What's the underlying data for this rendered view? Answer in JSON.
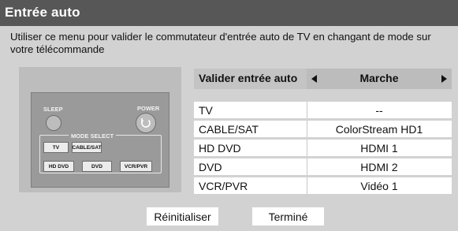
{
  "window": {
    "title": "Entrée auto"
  },
  "description": "Utiliser ce menu pour valider le commutateur d'entrée auto de TV en changant de mode sur votre télécommande",
  "remote": {
    "sleep_label": "SLEEP",
    "power_label": "POWER",
    "mode_select_label": "MODE SELECT",
    "mode_buttons": [
      "TV",
      "CABLE/SAT",
      "HD DVD",
      "DVD",
      "VCR/PVR"
    ]
  },
  "setting": {
    "label": "Valider entrée auto",
    "value": "Marche"
  },
  "inputs": [
    {
      "mode": "TV",
      "input": "--"
    },
    {
      "mode": "CABLE/SAT",
      "input": "ColorStream HD1"
    },
    {
      "mode": "HD DVD",
      "input": "HDMI 1"
    },
    {
      "mode": "DVD",
      "input": "HDMI 2"
    },
    {
      "mode": "VCR/PVR",
      "input": "Vidéo 1"
    }
  ],
  "buttons": {
    "reset": "Réinitialiser",
    "done": "Terminé"
  },
  "colors": {
    "title_bar": "#575757",
    "panel": "#d2d2d2",
    "row": "#ffffff"
  }
}
